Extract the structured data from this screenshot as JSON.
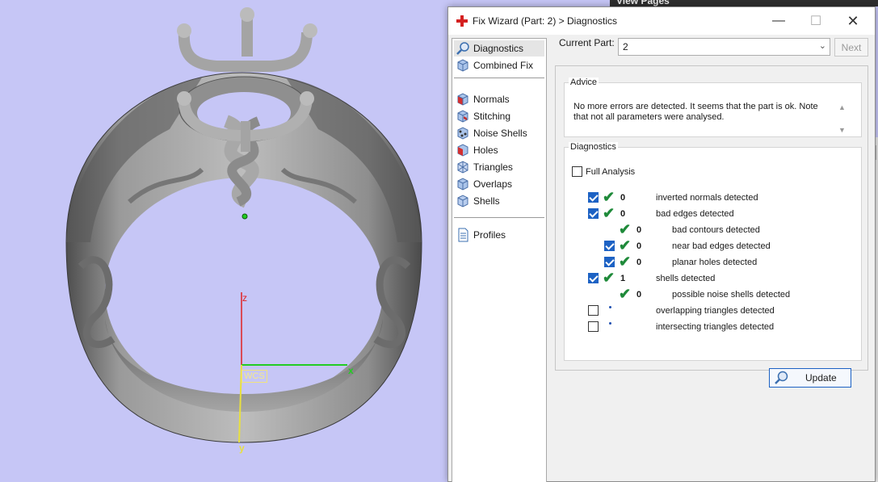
{
  "background_window": {
    "title": "View Pages"
  },
  "viewport": {
    "axes": {
      "x": "x",
      "y": "y",
      "z": "z"
    },
    "wcs_label": "WCS"
  },
  "dialog": {
    "title": "Fix Wizard (Part: 2) > Diagnostics",
    "window_buttons": {
      "minimize": "—",
      "maximize": "☐",
      "close": "✕"
    },
    "nav": {
      "items": [
        {
          "label": "Diagnostics",
          "icon": "magnifier-icon",
          "selected": true
        },
        {
          "label": "Combined Fix",
          "icon": "cube-fix-icon"
        },
        {
          "label": "Normals",
          "icon": "cube-red-face-icon"
        },
        {
          "label": "Stitching",
          "icon": "cube-stitch-icon"
        },
        {
          "label": "Noise Shells",
          "icon": "cube-noise-icon"
        },
        {
          "label": "Holes",
          "icon": "cube-hole-icon"
        },
        {
          "label": "Triangles",
          "icon": "cube-triangles-icon"
        },
        {
          "label": "Overlaps",
          "icon": "cube-overlap-icon"
        },
        {
          "label": "Shells",
          "icon": "cube-shells-icon"
        },
        {
          "label": "Profiles",
          "icon": "document-icon"
        }
      ]
    },
    "current_part": {
      "label": "Current Part:",
      "value": "2",
      "next_label": "Next"
    },
    "advice": {
      "label": "Advice",
      "line1": "No more errors are detected. It seems that the part is ok. Note",
      "line2": "that not all parameters were analysed."
    },
    "diagnostics": {
      "label": "Diagnostics",
      "full_analysis": {
        "label": "Full Analysis",
        "checked": false
      },
      "rows": [
        {
          "checked": true,
          "status": "ok",
          "count": "0",
          "label": "inverted normals detected",
          "level": 0
        },
        {
          "checked": true,
          "status": "ok",
          "count": "0",
          "label": "bad edges detected",
          "level": 0
        },
        {
          "checked": null,
          "status": "ok",
          "count": "0",
          "label": "bad contours detected",
          "level": 1
        },
        {
          "checked": true,
          "status": "ok",
          "count": "0",
          "label": "near bad edges detected",
          "level": 1
        },
        {
          "checked": true,
          "status": "ok",
          "count": "0",
          "label": "planar holes detected",
          "level": 1
        },
        {
          "checked": true,
          "status": "ok",
          "count": "1",
          "label": "shells detected",
          "level": 0
        },
        {
          "checked": null,
          "status": "ok",
          "count": "0",
          "label": "possible noise shells detected",
          "level": 1
        },
        {
          "checked": false,
          "status": "dot",
          "count": "",
          "label": "overlapping triangles detected",
          "level": 0
        },
        {
          "checked": false,
          "status": "dot",
          "count": "",
          "label": "intersecting triangles detected",
          "level": 0
        }
      ],
      "update_label": "Update"
    }
  },
  "colors": {
    "viewport_bg": "#c6c6f6",
    "accent": "#1d62c4",
    "ok_tick": "#1f8a3a",
    "axis_x": "#22cc22",
    "axis_y": "#e8e040",
    "axis_z": "#e02020"
  }
}
